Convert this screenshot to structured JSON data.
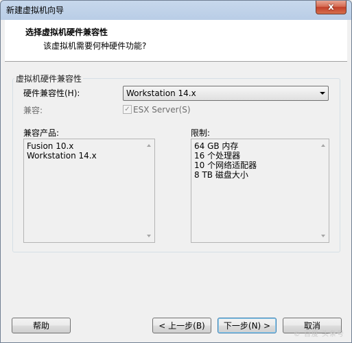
{
  "window": {
    "title": "新建虚拟机向导",
    "close_glyph": "x"
  },
  "header": {
    "title": "选择虚拟机硬件兼容性",
    "subtitle": "该虚拟机需要何种硬件功能?"
  },
  "group": {
    "legend": "虚拟机硬件兼容性",
    "hw_compat_label": "硬件兼容性(H):",
    "hw_compat_value": "Workstation 14.x",
    "compat_label": "兼容:",
    "esx_checkbox": {
      "label": "ESX Server(S)",
      "checked": true,
      "glyph": "✓"
    },
    "compatible_products_label": "兼容产品:",
    "compatible_products": [
      "Fusion 10.x",
      "Workstation 14.x"
    ],
    "limits_label": "限制:",
    "limits": [
      "64 GB 内存",
      "16 个处理器",
      "10 个网络适配器",
      "8 TB 磁盘大小"
    ]
  },
  "buttons": {
    "help": "帮助",
    "back": "< 上一步(B)",
    "next": "下一步(N) >",
    "cancel": "取消"
  },
  "watermark": "© 百度 头条号"
}
